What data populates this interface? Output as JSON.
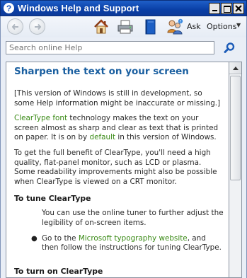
{
  "window": {
    "title": "Windows Help and Support",
    "app_icon_glyph": "?"
  },
  "toolbar": {
    "back_icon": "back-arrow-icon",
    "forward_icon": "forward-arrow-icon",
    "home_icon": "home-icon",
    "print_icon": "printer-icon",
    "browse_icon": "book-icon",
    "ask_icon": "people-icon",
    "ask_label": "Ask",
    "options_label": "Options",
    "options_caret": "▼"
  },
  "search": {
    "placeholder": "Search online Help",
    "icon": "magnifier-icon"
  },
  "article": {
    "title": "Sharpen the text on your screen",
    "notice": "[This version of Windows is still in development, so some Help information might be inaccurate or missing.]",
    "p1_link": "ClearType font",
    "p1_a": " technology makes the text on your screen almost as sharp and clear as text that is printed on paper. It is on by ",
    "p1_link2": "default",
    "p1_b": " in this version of Windows.",
    "p2": "To get the full benefit of ClearType, you'll need a high quality, flat-panel monitor, such as LCD or plasma. Some readability improvements might also be possible when ClearType is viewed on a CRT monitor.",
    "h1": "To tune ClearType",
    "h1_intro": "You can use the online tuner to further adjust the legibility of on-screen items.",
    "bullet_symbol": "●",
    "bullet1_a": "Go to the ",
    "bullet1_link": "Microsoft typography website",
    "bullet1_b": ", and then follow the instructions for tuning ClearType.",
    "h2": "To turn on ClearType"
  },
  "colors": {
    "title_bar": "#0a3fa6",
    "heading": "#1a5fa0",
    "link": "#3a8a16"
  }
}
